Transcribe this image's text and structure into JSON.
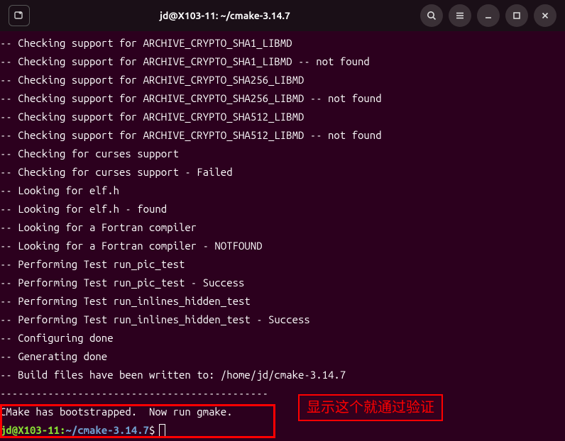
{
  "titlebar": {
    "title": "jd@X103-11: ~/cmake-3.14.7"
  },
  "terminal": {
    "lines": [
      "-- Checking support for ARCHIVE_CRYPTO_SHA1_LIBMD",
      "-- Checking support for ARCHIVE_CRYPTO_SHA1_LIBMD -- not found",
      "-- Checking support for ARCHIVE_CRYPTO_SHA256_LIBMD",
      "-- Checking support for ARCHIVE_CRYPTO_SHA256_LIBMD -- not found",
      "-- Checking support for ARCHIVE_CRYPTO_SHA512_LIBMD",
      "-- Checking support for ARCHIVE_CRYPTO_SHA512_LIBMD -- not found",
      "-- Checking for curses support",
      "-- Checking for curses support - Failed",
      "-- Looking for elf.h",
      "-- Looking for elf.h - found",
      "-- Looking for a Fortran compiler",
      "-- Looking for a Fortran compiler - NOTFOUND",
      "-- Performing Test run_pic_test",
      "-- Performing Test run_pic_test - Success",
      "-- Performing Test run_inlines_hidden_test",
      "-- Performing Test run_inlines_hidden_test - Success",
      "-- Configuring done",
      "-- Generating done",
      "-- Build files have been written to: /home/jd/cmake-3.14.7",
      "---------------------------------------------",
      "CMake has bootstrapped.  Now run gmake."
    ],
    "prompt": {
      "user": "jd@X103-11",
      "path": "~/cmake-3.14.7",
      "dollar": "$"
    }
  },
  "annotation": {
    "text": "显示这个就通过验证"
  }
}
